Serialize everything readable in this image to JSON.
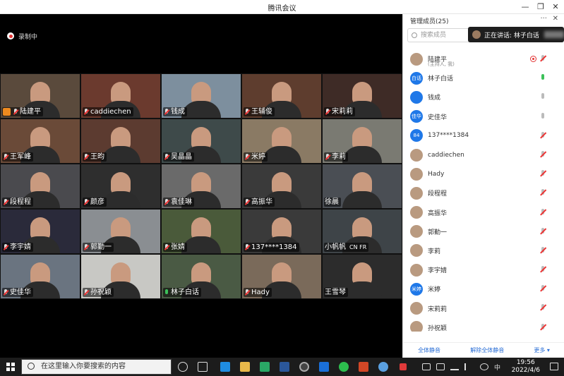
{
  "window": {
    "title": "腾讯会议",
    "minimize": "—",
    "restore": "❐",
    "close": "✕"
  },
  "recording": {
    "label": "录制中"
  },
  "tiles": [
    {
      "name": "陆建平",
      "mic": "muted",
      "host": true,
      "bg": "#5a4a3c"
    },
    {
      "name": "caddiechen",
      "mic": "muted",
      "bg": "#6b3a2e"
    },
    {
      "name": "钱成",
      "mic": "muted",
      "bg": "#7d8f9e"
    },
    {
      "name": "王辅俊",
      "mic": "muted",
      "bg": "#5e3d2e"
    },
    {
      "name": "宋莉莉",
      "mic": "muted",
      "bg": "#3e2b26"
    },
    {
      "name": "王军峰",
      "mic": "muted",
      "bg": "#6a4a38"
    },
    {
      "name": "王昀",
      "mic": "muted",
      "bg": "#5c3b30"
    },
    {
      "name": "吴晶晶",
      "mic": "muted",
      "bg": "#3e4a4a"
    },
    {
      "name": "米婷",
      "mic": "muted",
      "bg": "#8a7a64"
    },
    {
      "name": "李莉",
      "mic": "muted",
      "bg": "#7a7a72"
    },
    {
      "name": "段程程",
      "mic": "muted",
      "bg": "#4a4a4e"
    },
    {
      "name": "颜彦",
      "mic": "muted",
      "bg": "#2e2e2e"
    },
    {
      "name": "袁佳琳",
      "mic": "muted",
      "bg": "#6a6a6a"
    },
    {
      "name": "高振华",
      "mic": "muted",
      "bg": "#3a3a3a"
    },
    {
      "name": "徐晨",
      "mic": "none",
      "bg": "#4a4e54"
    },
    {
      "name": "李宇婧",
      "mic": "muted",
      "bg": "#2a2a3a"
    },
    {
      "name": "郭勤一",
      "mic": "muted",
      "bg": "#8a8e92"
    },
    {
      "name": "张婧",
      "mic": "muted",
      "bg": "#4a5a3a"
    },
    {
      "name": "137****1384",
      "mic": "muted",
      "bg": "#3a3a3a"
    },
    {
      "name": "小帆帆",
      "mic": "none",
      "extra": "CN FR",
      "bg": "#3e4448"
    },
    {
      "name": "史佳华",
      "mic": "muted",
      "bg": "#6a7480"
    },
    {
      "name": "孙祝颖",
      "mic": "muted",
      "bg": "#c8c8c4"
    },
    {
      "name": "林子白话",
      "mic": "active",
      "bg": "#4a5a44"
    },
    {
      "name": "Hady",
      "mic": "muted",
      "bg": "#7a6a5a"
    },
    {
      "name": "王雪琴",
      "mic": "none",
      "bg": "#2c2c2c"
    }
  ],
  "panel": {
    "title": "管理成员(25)",
    "more": "···",
    "close": "✕",
    "search_placeholder": "搜索成员",
    "speaking": "正在讲话: 林子白话",
    "members": [
      {
        "name": "陆建平",
        "sub": "(主持人, 我)",
        "status": "muted",
        "rec": true,
        "avatar": "photo"
      },
      {
        "name": "林子白话",
        "status": "active",
        "avatar": "blue",
        "initial": "白话"
      },
      {
        "name": "钱成",
        "status": "none",
        "avatar": "blue",
        "initial": ""
      },
      {
        "name": "史佳华",
        "status": "none",
        "avatar": "blue",
        "initial": "佳华"
      },
      {
        "name": "137****1384",
        "status": "muted",
        "avatar": "blue",
        "initial": "84"
      },
      {
        "name": "caddiechen",
        "status": "muted",
        "avatar": "photo"
      },
      {
        "name": "Hady",
        "status": "muted",
        "avatar": "photo"
      },
      {
        "name": "段程程",
        "status": "muted",
        "avatar": "photo"
      },
      {
        "name": "高振华",
        "status": "muted",
        "avatar": "photo"
      },
      {
        "name": "郭勤一",
        "status": "muted",
        "avatar": "photo"
      },
      {
        "name": "李莉",
        "status": "muted",
        "avatar": "photo"
      },
      {
        "name": "李宇婧",
        "status": "muted",
        "avatar": "photo"
      },
      {
        "name": "米婷",
        "status": "muted",
        "avatar": "blue",
        "initial": "米婷"
      },
      {
        "name": "宋莉莉",
        "status": "muted",
        "avatar": "photo"
      },
      {
        "name": "孙祝颖",
        "status": "muted",
        "avatar": "photo"
      }
    ],
    "footer": {
      "mute_all": "全体静音",
      "unmute_all": "解除全体静音",
      "more": "更多 ▾"
    }
  },
  "taskbar": {
    "search_placeholder": "在这里输入你要搜索的内容",
    "ime": "中",
    "time": "19:56",
    "date": "2022/4/6"
  }
}
